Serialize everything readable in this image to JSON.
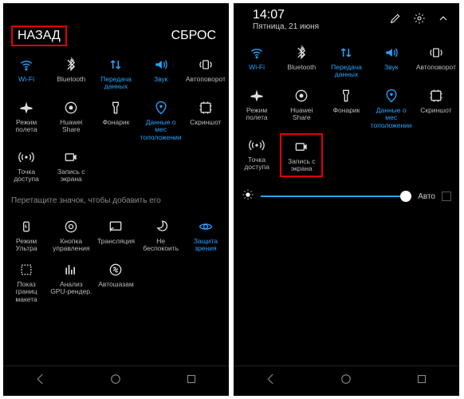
{
  "left": {
    "header": {
      "back": "НАЗАД",
      "reset": "СБРОС"
    },
    "tiles_active": [
      {
        "id": "wifi",
        "label": "Wi-Fi",
        "on": true
      },
      {
        "id": "bluetooth",
        "label": "Bluetooth",
        "on": false
      },
      {
        "id": "mobiledata",
        "label": "Передача данных",
        "on": true
      },
      {
        "id": "sound",
        "label": "Звук",
        "on": true
      },
      {
        "id": "autorotate",
        "label": "Автоповорот",
        "on": false
      },
      {
        "id": "airplane",
        "label": "Режим полета",
        "on": false
      },
      {
        "id": "huaweishare",
        "label": "Huawei Share",
        "on": false
      },
      {
        "id": "flashlight",
        "label": "Фонарик",
        "on": false
      },
      {
        "id": "location",
        "label": "Данные о мес тоположении",
        "on": true
      },
      {
        "id": "screenshot",
        "label": "Скриншот",
        "on": false
      },
      {
        "id": "hotspot",
        "label": "Точка доступа",
        "on": false
      },
      {
        "id": "screenrec",
        "label": "Запись с экрана",
        "on": false
      }
    ],
    "drag_hint": "Перетащите значок, чтобы добавить его",
    "tiles_inactive": [
      {
        "id": "ultra",
        "label": "Режим Ультра"
      },
      {
        "id": "navbutton",
        "label": "Кнопка управления"
      },
      {
        "id": "cast",
        "label": "Трансляция"
      },
      {
        "id": "dnd",
        "label": "Не беспокоить"
      },
      {
        "id": "eyecomfort",
        "label": "Защита зрения",
        "on": true
      },
      {
        "id": "layoutbounds",
        "label": "Показ границ макета"
      },
      {
        "id": "gpurender",
        "label": "Анализ GPU-рендер."
      },
      {
        "id": "autoshazam",
        "label": "Автошазам"
      }
    ]
  },
  "right": {
    "time": "14:07",
    "date": "Пятница, 21 июня",
    "tiles": [
      {
        "id": "wifi",
        "label": "Wi-Fi",
        "on": true
      },
      {
        "id": "bluetooth",
        "label": "Bluetooth",
        "on": false
      },
      {
        "id": "mobiledata",
        "label": "Передача данных",
        "on": true
      },
      {
        "id": "sound",
        "label": "Звук",
        "on": true
      },
      {
        "id": "autorotate",
        "label": "Автоповорот",
        "on": false
      },
      {
        "id": "airplane",
        "label": "Режим полета",
        "on": false
      },
      {
        "id": "huaweishare",
        "label": "Huawei Share",
        "on": false
      },
      {
        "id": "flashlight",
        "label": "Фонарик",
        "on": false
      },
      {
        "id": "location",
        "label": "Данные о мес тоположении",
        "on": true
      },
      {
        "id": "screenshot",
        "label": "Скриншот",
        "on": false
      },
      {
        "id": "hotspot",
        "label": "Точка доступа",
        "on": false
      },
      {
        "id": "screenrec",
        "label": "Запись с экрана",
        "on": false,
        "highlight": true
      }
    ],
    "auto_label": "Авто"
  }
}
